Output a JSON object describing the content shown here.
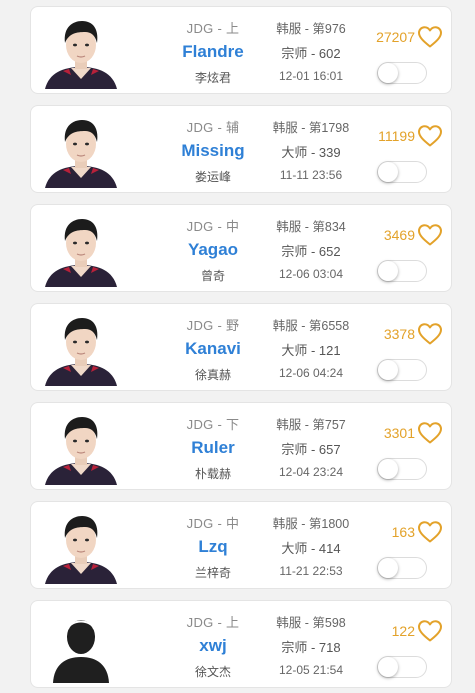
{
  "colors": {
    "name_blue": "#2f80d6",
    "likes_gold": "#e3a22a",
    "jersey_dark": "#2a2238",
    "jersey_red": "#b8213a"
  },
  "players": [
    {
      "team": "JDG - 上",
      "name": "Flandre",
      "realname": "李炫君",
      "server": "韩服 - 第976",
      "tier": "宗师 - 602",
      "time": "12-01 16:01",
      "likes": "27207",
      "avatar": "photo",
      "liked": false
    },
    {
      "team": "JDG - 辅",
      "name": "Missing",
      "realname": "娄运峰",
      "server": "韩服 - 第1798",
      "tier": "大师 - 339",
      "time": "11-11 23:56",
      "likes": "11199",
      "avatar": "photo",
      "liked": false
    },
    {
      "team": "JDG - 中",
      "name": "Yagao",
      "realname": "曾奇",
      "server": "韩服 - 第834",
      "tier": "宗师 - 652",
      "time": "12-06 03:04",
      "likes": "3469",
      "avatar": "photo",
      "liked": false
    },
    {
      "team": "JDG - 野",
      "name": "Kanavi",
      "realname": "徐真赫",
      "server": "韩服 - 第6558",
      "tier": "大师 - 121",
      "time": "12-06 04:24",
      "likes": "3378",
      "avatar": "photo",
      "liked": false
    },
    {
      "team": "JDG - 下",
      "name": "Ruler",
      "realname": "朴载赫",
      "server": "韩服 - 第757",
      "tier": "宗师 - 657",
      "time": "12-04 23:24",
      "likes": "3301",
      "avatar": "photo",
      "liked": false
    },
    {
      "team": "JDG - 中",
      "name": "Lzq",
      "realname": "兰梓奇",
      "server": "韩服 - 第1800",
      "tier": "大师 - 414",
      "time": "11-21 22:53",
      "likes": "163",
      "avatar": "photo",
      "liked": false
    },
    {
      "team": "JDG - 上",
      "name": "xwj",
      "realname": "徐文杰",
      "server": "韩服 - 第598",
      "tier": "宗师 - 718",
      "time": "12-05 21:54",
      "likes": "122",
      "avatar": "placeholder",
      "liked": false
    }
  ]
}
